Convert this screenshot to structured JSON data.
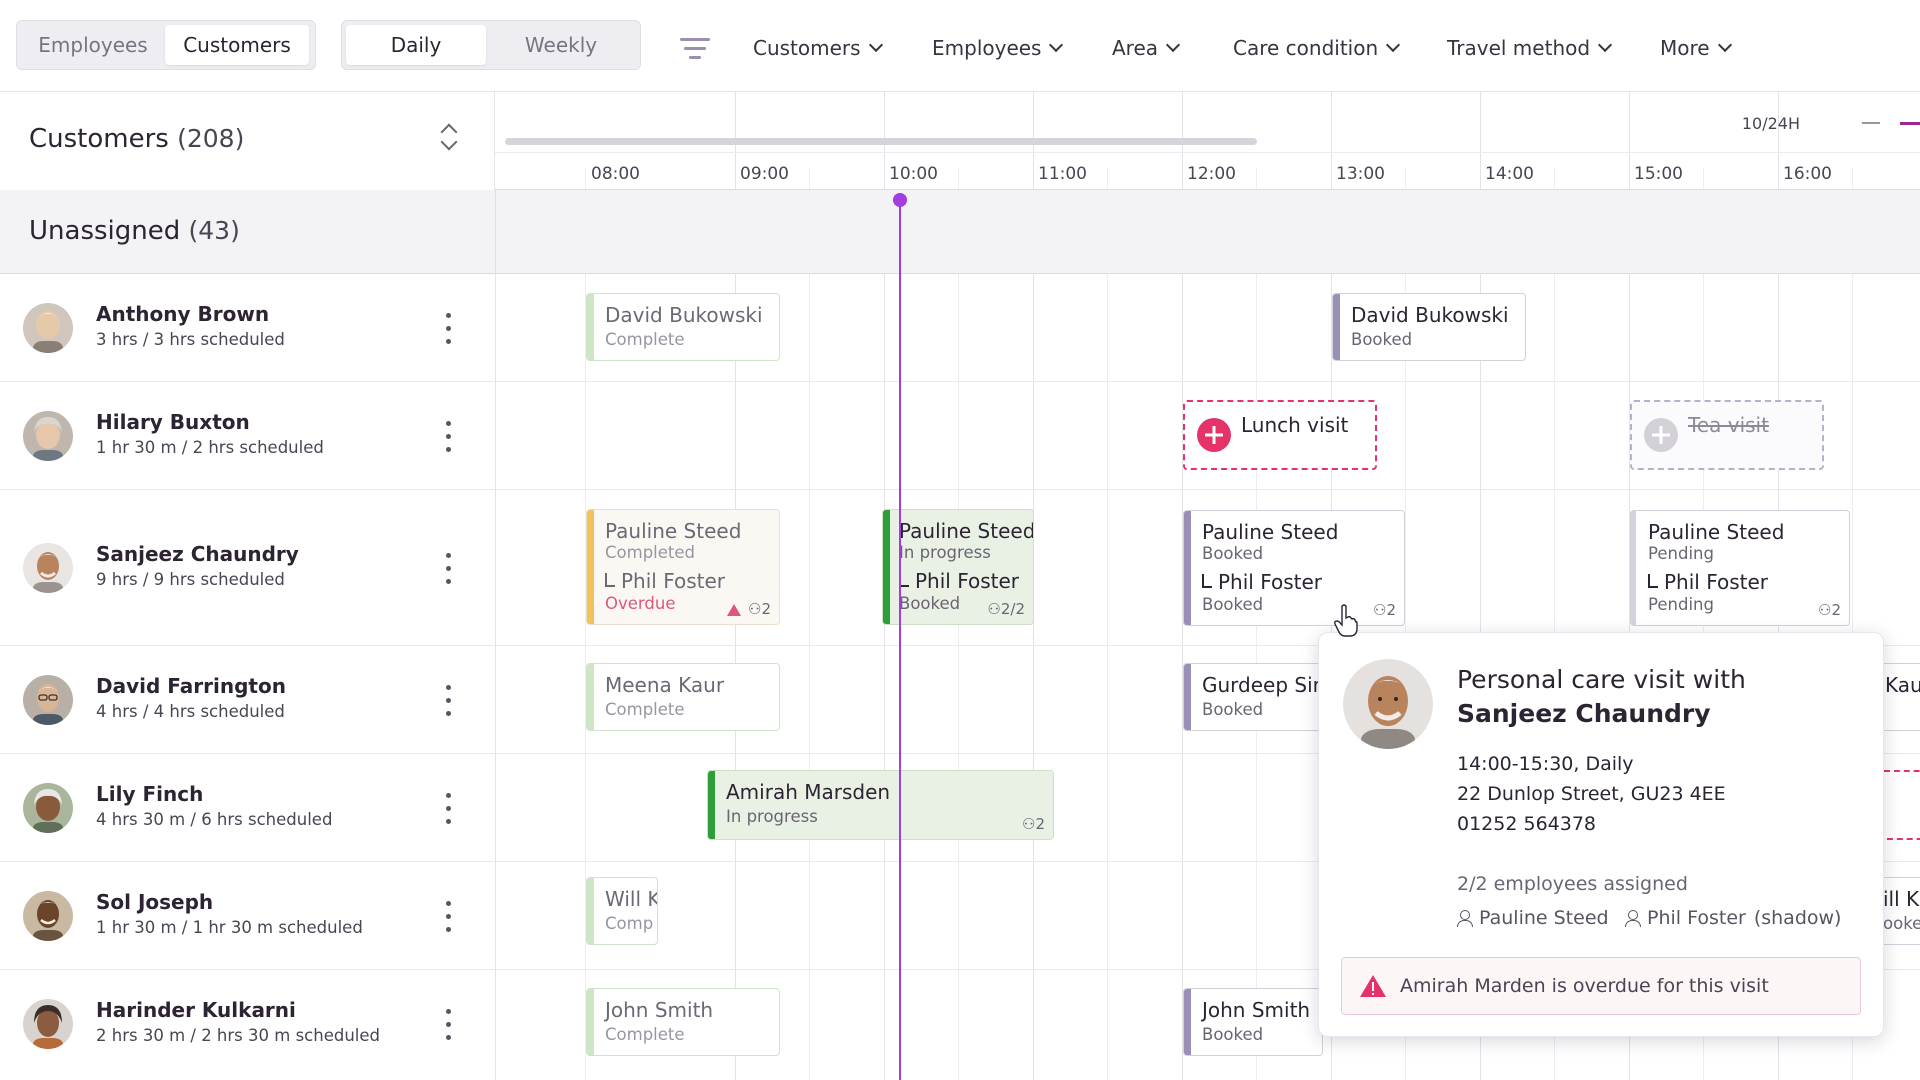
{
  "toolbar": {
    "view_toggle": {
      "employees": "Employees",
      "customers": "Customers",
      "selected": "Customers"
    },
    "range_toggle": {
      "daily": "Daily",
      "weekly": "Weekly",
      "selected": "Daily"
    },
    "filters": [
      "Customers",
      "Employees",
      "Area",
      "Care condition",
      "Travel method",
      "More"
    ],
    "filter_icon": "filter-icon"
  },
  "list_header": {
    "title": "Customers",
    "count": "(208)"
  },
  "timeline": {
    "zoom_label": "10/24H",
    "hours": [
      "08:00",
      "09:00",
      "10:00",
      "11:00",
      "12:00",
      "13:00",
      "14:00",
      "15:00",
      "16:00"
    ]
  },
  "unassigned": {
    "title": "Unassigned",
    "count": "(43)"
  },
  "rows": [
    {
      "name": "Anthony Brown",
      "schedule": "3 hrs / 3 hrs scheduled"
    },
    {
      "name": "Hilary Buxton",
      "schedule": "1 hr 30 m / 2 hrs scheduled"
    },
    {
      "name": "Sanjeez Chaundry",
      "schedule": "9 hrs / 9 hrs scheduled"
    },
    {
      "name": "David Farrington",
      "schedule": "4 hrs / 4 hrs scheduled"
    },
    {
      "name": "Lily Finch",
      "schedule": "4 hrs 30 m / 6 hrs scheduled"
    },
    {
      "name": "Sol Joseph",
      "schedule": "1 hr 30 m / 1 hr 30 m scheduled"
    },
    {
      "name": "Harinder Kulkarni",
      "schedule": "2 hrs 30 m / 2 hrs 30 m scheduled"
    }
  ],
  "visits": {
    "r0a": {
      "title": "David Bukowski",
      "status": "Complete"
    },
    "r0b": {
      "title": "David Bukowski",
      "status": "Booked"
    },
    "r1a": {
      "title": "Lunch visit"
    },
    "r1b": {
      "title": "Tea visit"
    },
    "r2a": {
      "title": "Pauline Steed",
      "status": "Completed",
      "sub": "Phil Foster",
      "sub_status": "Overdue",
      "badge": "2"
    },
    "r2b": {
      "title": "Pauline Steed",
      "status": "In progress",
      "sub": "Phil Foster",
      "sub_status": "Booked",
      "badge": "2/2"
    },
    "r2c": {
      "title": "Pauline Steed",
      "status": "Booked",
      "sub": "Phil Foster",
      "sub_status": "Booked",
      "badge": "2"
    },
    "r2d": {
      "title": "Pauline Steed",
      "status": "Pending",
      "sub": "Phil Foster",
      "sub_status": "Pending",
      "badge": "2"
    },
    "r3a": {
      "title": "Meena Kaur",
      "status": "Complete"
    },
    "r3b": {
      "title": "Gurdeep Sin",
      "status": "Booked"
    },
    "r3c": {
      "title": "Kau"
    },
    "r4a": {
      "title": "Amirah Marsden",
      "status": "In progress",
      "badge": "2"
    },
    "r5a": {
      "title": "Will K",
      "status": "Comp"
    },
    "r5b": {
      "title": "ill Ki",
      "status": "ooke"
    },
    "r6a": {
      "title": "John Smith",
      "status": "Complete"
    },
    "r6b": {
      "title": "John Smith",
      "status": "Booked"
    }
  },
  "popover": {
    "title": "Personal care visit with",
    "customer": "Sanjeez Chaundry",
    "time": "14:00-15:30, Daily",
    "address": "22 Dunlop Street, GU23 4EE",
    "phone": "01252 564378",
    "assigned": "2/2 employees assigned",
    "employee_1": "Pauline Steed",
    "employee_2": "Phil Foster",
    "employee_2_role": "(shadow)",
    "alert": "Amirah Marden is overdue for this visit"
  },
  "colors": {
    "accent_purple": "#a23ee0",
    "booked_bar": "#9a8fb6",
    "complete_bar": "#cfe6c6",
    "in_progress_bar": "#2e9e3a",
    "overdue_bar": "#f0c45a",
    "alert_red": "#e5336a"
  }
}
